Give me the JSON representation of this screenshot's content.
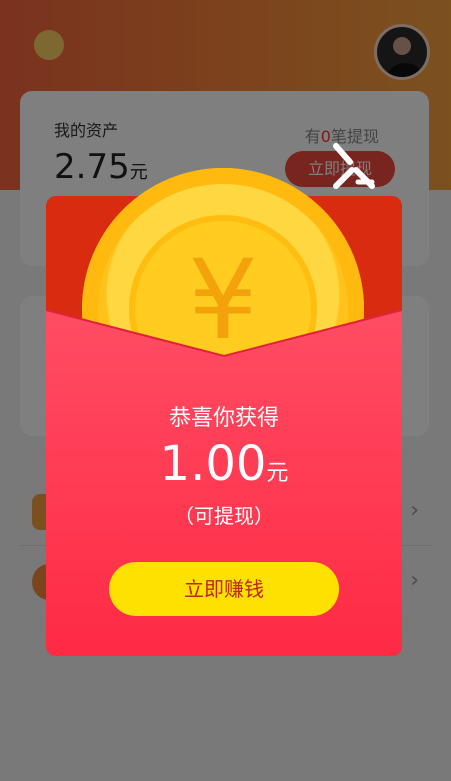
{
  "asset": {
    "title": "我的资产",
    "amount": "2.75",
    "unit": "元",
    "withdraw_prefix": "有",
    "withdraw_count": "0",
    "withdraw_suffix": "笔提现",
    "withdraw_button": "立即提现"
  },
  "modal": {
    "coin_symbol": "¥",
    "congrats": "恭喜你获得",
    "amount": "1.00",
    "unit": "元",
    "note": "（可提现）",
    "button": "立即赚钱"
  },
  "colors": {
    "header": "#f6643c",
    "modal_red": "#ff3550",
    "button_yellow": "#ffe100",
    "coin": "#ffcc1f"
  },
  "icons": {
    "close": "close-icon",
    "chevron": "chevron-right-icon"
  }
}
